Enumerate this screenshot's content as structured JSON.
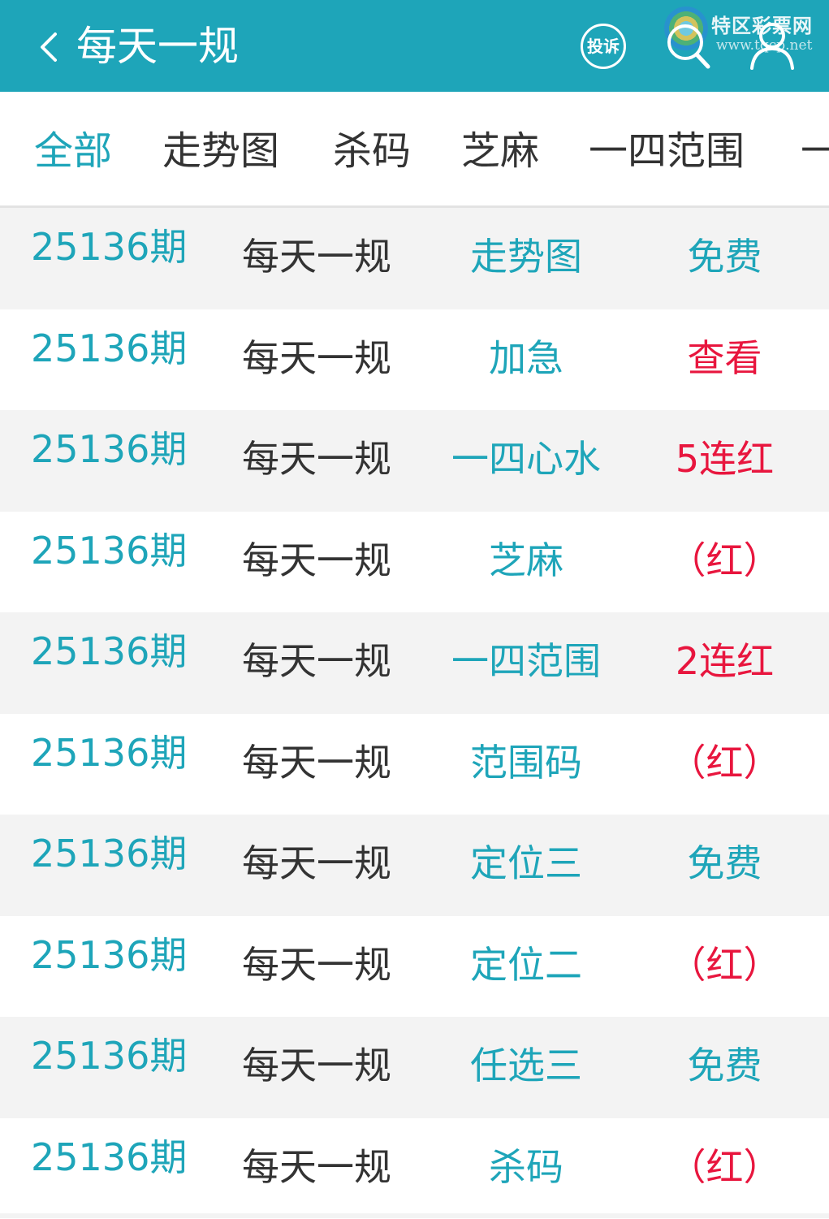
{
  "header": {
    "title": "每天一规",
    "complain_label": "投诉",
    "logo": {
      "name": "特区彩票网",
      "url": "www.tqcp.net"
    }
  },
  "tabs": [
    "全部",
    "走势图",
    "杀码",
    "芝麻",
    "一四范围",
    "一"
  ],
  "rows": [
    {
      "issue": "25136期",
      "name": "每天一规",
      "category": "走势图",
      "result": "免费"
    },
    {
      "issue": "25136期",
      "name": "每天一规",
      "category": "加急",
      "result": "查看"
    },
    {
      "issue": "25136期",
      "name": "每天一规",
      "category": "一四心水",
      "result": "5连红"
    },
    {
      "issue": "25136期",
      "name": "每天一规",
      "category": "芝麻",
      "result": "（红）"
    },
    {
      "issue": "25136期",
      "name": "每天一规",
      "category": "一四范围",
      "result": "2连红"
    },
    {
      "issue": "25136期",
      "name": "每天一规",
      "category": "范围码",
      "result": "（红）"
    },
    {
      "issue": "25136期",
      "name": "每天一规",
      "category": "定位三",
      "result": "免费"
    },
    {
      "issue": "25136期",
      "name": "每天一规",
      "category": "定位二",
      "result": "（红）"
    },
    {
      "issue": "25136期",
      "name": "每天一规",
      "category": "任选三",
      "result": "免费"
    },
    {
      "issue": "25136期",
      "name": "每天一规",
      "category": "杀码",
      "result": "（红）"
    }
  ],
  "colors": {
    "accent": "#1ea5b9",
    "red": "#e8163e",
    "text": "#333333",
    "row_alt": "#f3f3f3"
  }
}
